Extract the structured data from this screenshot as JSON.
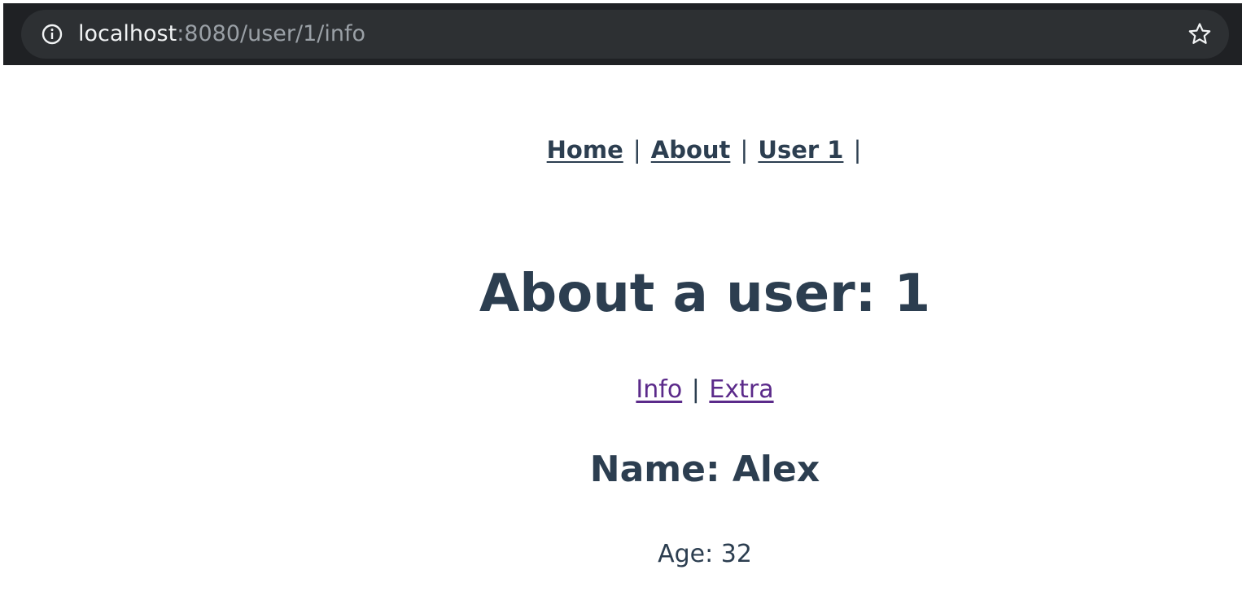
{
  "browser": {
    "url_host": "localhost",
    "url_rest": ":8080/user/1/info"
  },
  "nav": {
    "items": [
      {
        "label": "Home"
      },
      {
        "label": "About"
      },
      {
        "label": "User 1"
      }
    ],
    "separator": "|"
  },
  "main": {
    "title": "About a user: 1",
    "subnav": {
      "items": [
        {
          "label": "Info"
        },
        {
          "label": "Extra"
        }
      ],
      "separator": "|"
    },
    "name": "Name: Alex",
    "age": "Age: 32"
  },
  "colors": {
    "text": "#2c3e50",
    "visited_link": "#5b2a8a",
    "browser_bar": "#1f2124"
  },
  "icons": {
    "address_left": "info-circle-icon",
    "address_right": "star-icon"
  }
}
